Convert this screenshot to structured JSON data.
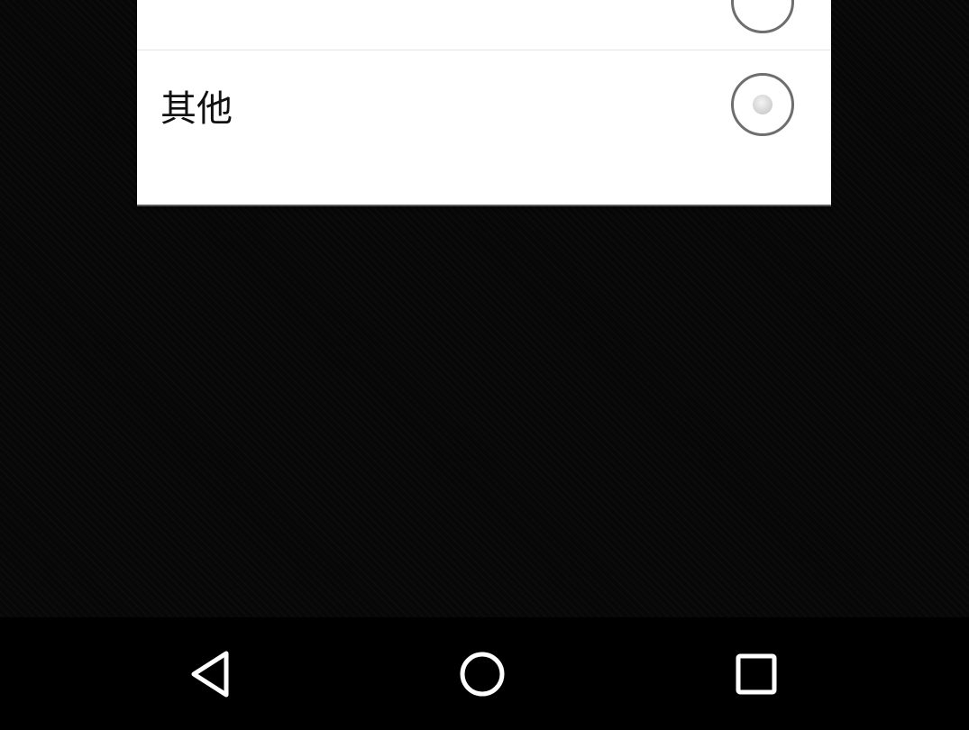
{
  "dialog": {
    "options": [
      {
        "label": "",
        "selected": false
      },
      {
        "label": "其他",
        "selected": true
      }
    ]
  },
  "navigation_bar": {
    "buttons": [
      {
        "icon": "back-triangle-icon"
      },
      {
        "icon": "home-circle-icon"
      },
      {
        "icon": "recents-square-icon"
      }
    ]
  },
  "colors": {
    "background": "#070707",
    "dialog_background": "#ffffff",
    "radio_ring": "#6e6e6e",
    "nav_icon": "#ffffff"
  }
}
